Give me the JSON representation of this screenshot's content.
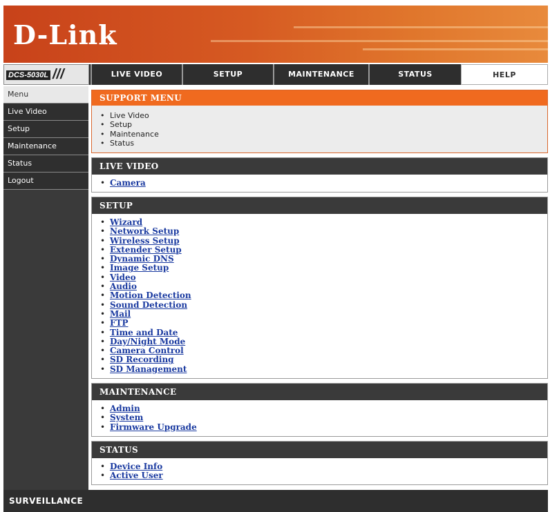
{
  "brand": {
    "logo": "D-Link",
    "model": "DCS-5030L",
    "footer": "SURVEILLANCE"
  },
  "nav": {
    "tabs": [
      {
        "label": "LIVE VIDEO"
      },
      {
        "label": "SETUP"
      },
      {
        "label": "MAINTENANCE"
      },
      {
        "label": "STATUS"
      },
      {
        "label": "HELP",
        "active": true
      }
    ]
  },
  "sidebar": {
    "items": [
      {
        "label": "Menu"
      },
      {
        "label": "Live Video"
      },
      {
        "label": "Setup"
      },
      {
        "label": "Maintenance"
      },
      {
        "label": "Status"
      },
      {
        "label": "Logout"
      }
    ]
  },
  "support": {
    "title": "SUPPORT MENU",
    "items": [
      "Live Video",
      "Setup",
      "Maintenance",
      "Status"
    ]
  },
  "live": {
    "title": "LIVE VIDEO",
    "links": [
      "Camera"
    ]
  },
  "setup": {
    "title": "SETUP",
    "links": [
      "Wizard",
      "Network Setup",
      "Wireless Setup",
      "Extender Setup",
      "Dynamic DNS",
      "Image Setup",
      "Video",
      "Audio",
      "Motion Detection",
      "Sound Detection",
      "Mail",
      "FTP",
      "Time and Date",
      "Day/Night Mode",
      "Camera Control",
      "SD Recording",
      "SD Management"
    ]
  },
  "maintenance": {
    "title": "MAINTENANCE",
    "links": [
      "Admin",
      "System",
      "Firmware Upgrade"
    ]
  },
  "status": {
    "title": "STATUS",
    "links": [
      "Device Info",
      "Active User"
    ]
  },
  "colors": {
    "header_orange": "#d65a22",
    "support_head": "#f06a1f",
    "dark_bar": "#3a3a3a",
    "link_blue": "#1a3aa0"
  }
}
